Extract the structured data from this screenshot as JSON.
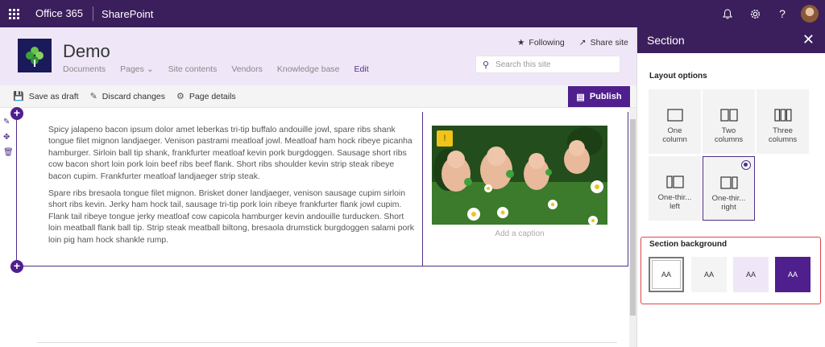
{
  "suite": {
    "brand": "Office 365",
    "app": "SharePoint"
  },
  "site": {
    "title": "Demo",
    "nav": [
      "Documents",
      "Pages",
      "Site contents",
      "Vendors",
      "Knowledge base",
      "Edit"
    ],
    "following": "Following",
    "share": "Share site",
    "search_placeholder": "Search this site"
  },
  "toolbar": {
    "save_draft": "Save as draft",
    "discard": "Discard changes",
    "page_details": "Page details",
    "publish": "Publish"
  },
  "content": {
    "para1": "Spicy jalapeno bacon ipsum dolor amet leberkas tri-tip buffalo andouille jowl, spare ribs shank tongue filet mignon landjaeger. Venison pastrami meatloaf jowl. Meatloaf ham hock ribeye picanha hamburger. Sirloin ball tip shank, frankfurter meatloaf kevin pork burgdoggen. Sausage short ribs cow bacon short loin pork loin beef ribs beef flank. Short ribs shoulder kevin strip steak ribeye bacon cupim. Frankfurter meatloaf landjaeger strip steak.",
    "para2": "Spare ribs bresaola tongue filet mignon. Brisket doner landjaeger, venison sausage cupim sirloin short ribs kevin. Jerky ham hock tail, sausage tri-tip pork loin ribeye frankfurter flank jowl cupim. Flank tail ribeye tongue jerky meatloaf cow capicola hamburger kevin andouille turducken. Short loin meatball flank ball tip. Strip steak meatball biltong, bresaola drumstick burgdoggen salami pork loin pig ham hock shankle rump.",
    "caption_placeholder": "Add a caption"
  },
  "panel": {
    "title": "Section",
    "layout_heading": "Layout options",
    "layouts": [
      {
        "line1": "One",
        "line2": "column"
      },
      {
        "line1": "Two",
        "line2": "columns"
      },
      {
        "line1": "Three",
        "line2": "columns"
      },
      {
        "line1": "One-thir...",
        "line2": "left"
      },
      {
        "line1": "One-thir...",
        "line2": "right"
      }
    ],
    "selected_layout": "One-third right",
    "background_heading": "Section background",
    "swatch_label": "AA",
    "swatch_colors": [
      "#ffffff",
      "#f4f4f4",
      "#efe7f7",
      "#4f1f8e"
    ]
  },
  "colors": {
    "suite": "#3b1f5c",
    "accent": "#4f1f8e",
    "header_bg": "#efe7f7"
  }
}
